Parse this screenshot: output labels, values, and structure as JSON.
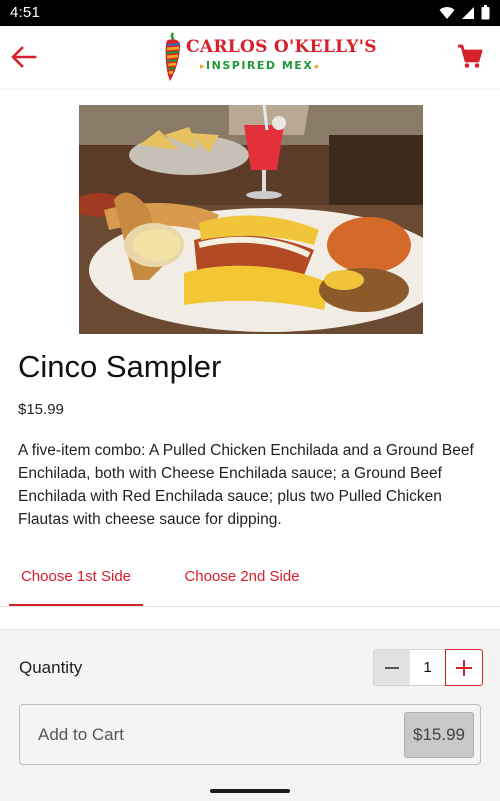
{
  "status_bar": {
    "time": "4:51"
  },
  "header": {
    "logo_line1": "CARLOS O'KELLY'S",
    "logo_line2": "INSPIRED MEX",
    "accent_color": "#d6202a",
    "logo_green": "#1e9a3a",
    "back_icon": "arrow-left-icon",
    "cart_icon": "shopping-cart-icon"
  },
  "product": {
    "name": "Cinco Sampler",
    "price": "$15.99",
    "description": "A five-item combo: A Pulled Chicken Enchilada and a Ground Beef Enchilada, both with Cheese Enchilada sauce; a Ground Beef Enchilada with Red Enchilada sauce; plus two Pulled Chicken Flautas with cheese sauce for dipping."
  },
  "tabs": [
    {
      "label": "Choose 1st Side",
      "selected": true
    },
    {
      "label": "Choose 2nd Side",
      "selected": false
    }
  ],
  "order": {
    "quantity_label": "Quantity",
    "quantity_value": "1",
    "add_to_cart_label": "Add to Cart",
    "add_to_cart_price": "$15.99"
  }
}
